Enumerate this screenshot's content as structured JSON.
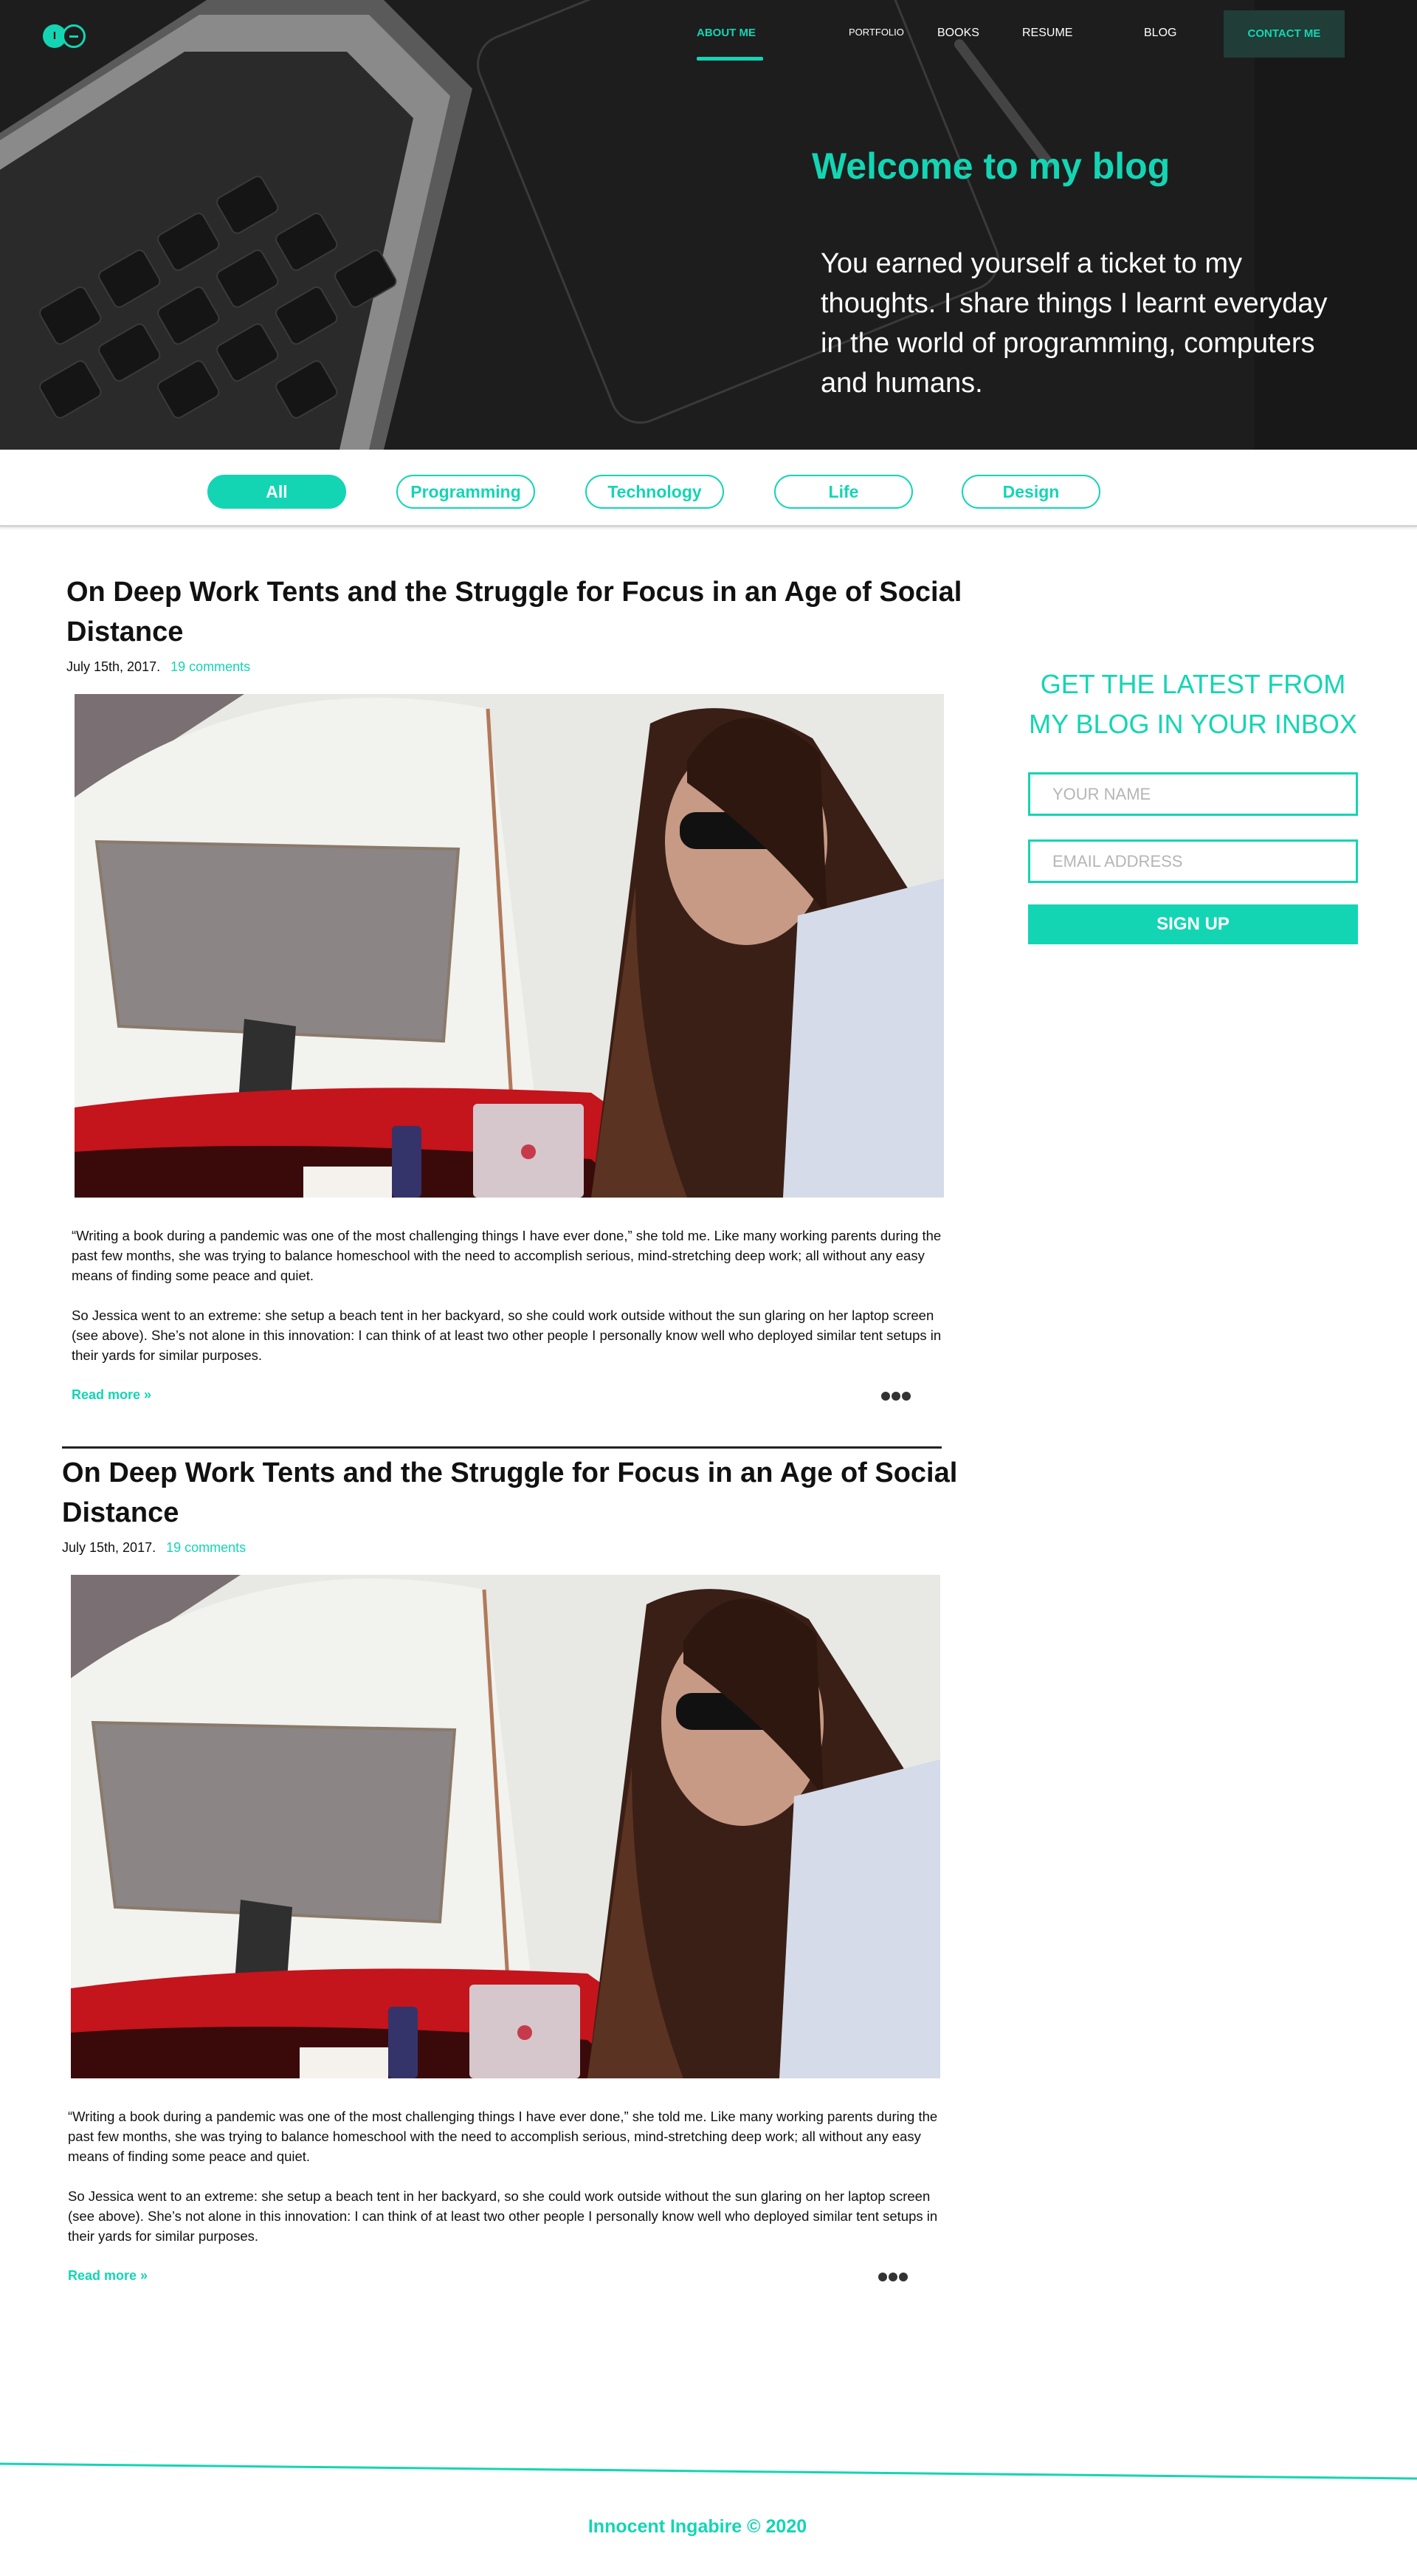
{
  "nav": {
    "logo_letter": "I",
    "items": [
      {
        "label": "ABOUT ME",
        "active": true
      },
      {
        "label": "PORTFOLIO"
      },
      {
        "label": "BOOKS"
      },
      {
        "label": "RESUME"
      },
      {
        "label": "BLOG"
      }
    ],
    "contact_label": "CONTACT ME"
  },
  "hero": {
    "title": "Welcome to my blog",
    "text": "You earned yourself a ticket to my thoughts. I share things I learnt everyday in the world of programming, computers and humans."
  },
  "filters": [
    {
      "label": "All",
      "active": true
    },
    {
      "label": "Programming"
    },
    {
      "label": "Technology"
    },
    {
      "label": "Life"
    },
    {
      "label": "Design"
    }
  ],
  "posts": [
    {
      "title": "On Deep Work Tents and the Struggle for Focus in an Age of Social Distance",
      "date": "July 15th, 2017.",
      "comments": "19 comments",
      "paragraph1": "“Writing a book during a pandemic was one of the most challenging things I have ever done,” she told me. Like many working parents during the past few months, she was trying to balance homeschool with the need to accomplish serious, mind-stretching deep work; all without any easy means of finding some peace and quiet.",
      "paragraph2": "So Jessica went to an extreme: she setup a beach tent in her backyard, so she could work outside without the sun glaring on her laptop screen (see above). She’s not alone in this innovation: I can think of at least two other people I personally know well who deployed similar tent setups in their yards for similar purposes.",
      "read_more": "Read more »"
    },
    {
      "title": "On Deep Work Tents and the Struggle for Focus in an Age of Social Distance",
      "date": "July 15th, 2017.",
      "comments": "19 comments",
      "paragraph1": "“Writing a book during a pandemic was one of the most challenging things I have ever done,” she told me. Like many working parents during the past few months, she was trying to balance homeschool with the need to accomplish serious, mind-stretching deep work; all without any easy means of finding some peace and quiet.",
      "paragraph2": "So Jessica went to an extreme: she setup a beach tent in her backyard, so she could work outside without the sun glaring on her laptop screen (see above). She’s not alone in this innovation: I can think of at least two other people I personally know well who deployed similar tent setups in their yards for similar purposes.",
      "read_more": "Read more »"
    }
  ],
  "sidebar": {
    "heading": "GET THE LATEST FROM MY BLOG IN YOUR INBOX",
    "name_placeholder": "YOUR NAME",
    "email_placeholder": "EMAIL ADDRESS",
    "signup_label": "SIGN UP"
  },
  "footer": {
    "text": "Innocent Ingabire  © 2020"
  },
  "colors": {
    "accent": "#14d5b3",
    "hero_bg": "#1c1c1c",
    "contact_bg": "#203d37"
  },
  "icons": [
    "logo-icon",
    "more-dots-icon"
  ]
}
